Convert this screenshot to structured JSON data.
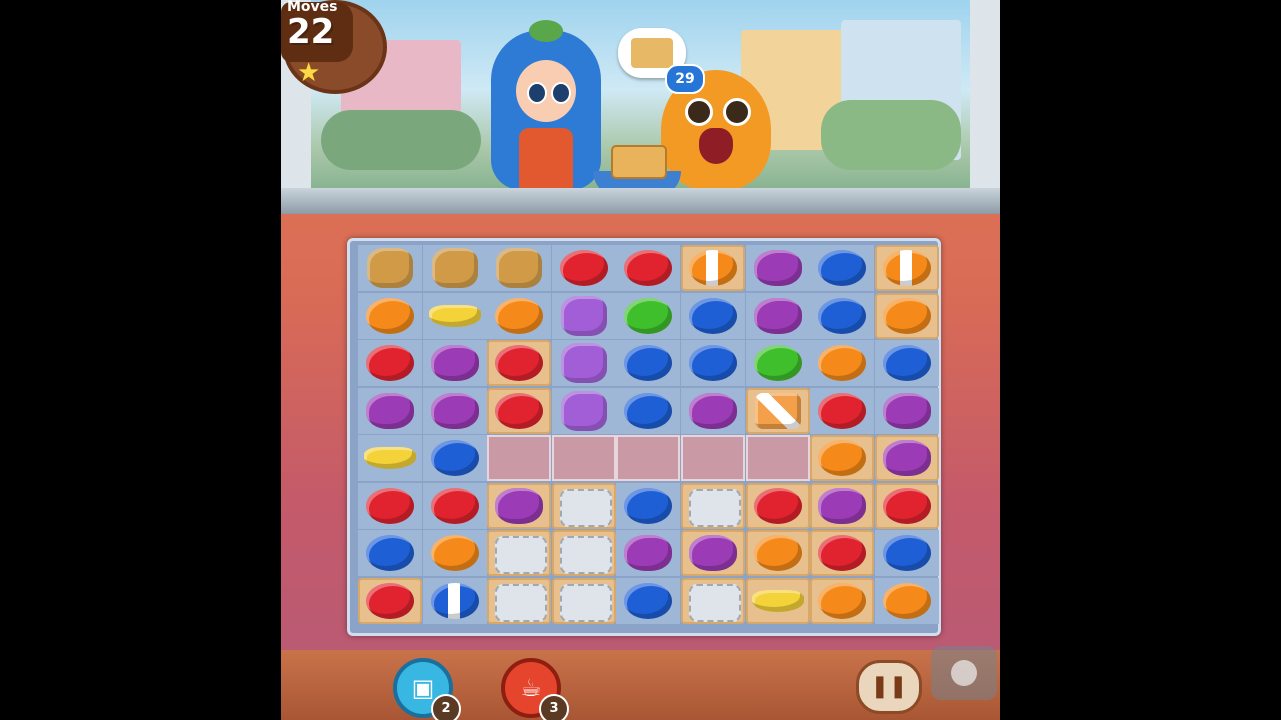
{
  "hud": {
    "moves_label": "Moves",
    "moves_value": "22",
    "goal_count": "29",
    "goal_item": "cracker-icon"
  },
  "boosters": [
    {
      "name": "apple-booster",
      "count": "2",
      "color": "#39b7e3"
    },
    {
      "name": "teapot-booster",
      "count": "3",
      "color": "#e4452c"
    }
  ],
  "board": {
    "rows": 8,
    "cols": 9,
    "grid": [
      [
        "cookie-burst",
        "cookie-burst",
        "cookie-burst",
        "strawberry",
        "strawberry",
        "orange-striped",
        "grape",
        "blueberry",
        "orange-striped"
      ],
      [
        "orange",
        "banana",
        "orange",
        "purple-burst",
        "apple",
        "blueberry",
        "grape",
        "blueberry",
        "orange"
      ],
      [
        "strawberry",
        "grape",
        "strawberry",
        "purple-burst",
        "blueberry",
        "blueberry",
        "apple",
        "orange",
        "blueberry"
      ],
      [
        "grape",
        "grape",
        "strawberry",
        "purple-burst",
        "blueberry",
        "grape",
        "orange-bomb",
        "strawberry",
        "grape"
      ],
      [
        "banana",
        "blueberry",
        "empty",
        "empty",
        "empty",
        "empty",
        "empty",
        "orange",
        "grape"
      ],
      [
        "strawberry",
        "strawberry",
        "grape",
        "basket",
        "blueberry",
        "basket",
        "strawberry",
        "grape",
        "strawberry"
      ],
      [
        "blueberry",
        "orange",
        "basket",
        "basket",
        "grape",
        "grape",
        "orange",
        "strawberry",
        "blueberry"
      ],
      [
        "strawberry",
        "blueberry-striped",
        "basket",
        "basket",
        "blueberry",
        "basket",
        "banana",
        "orange",
        "orange"
      ]
    ],
    "tiles": [
      [
        0,
        0,
        0,
        0,
        0,
        1,
        0,
        0,
        1
      ],
      [
        0,
        0,
        0,
        0,
        0,
        0,
        0,
        0,
        1
      ],
      [
        0,
        0,
        1,
        0,
        0,
        0,
        0,
        0,
        0
      ],
      [
        0,
        0,
        1,
        0,
        0,
        0,
        1,
        0,
        0
      ],
      [
        0,
        0,
        2,
        2,
        2,
        2,
        2,
        1,
        1
      ],
      [
        0,
        0,
        1,
        1,
        0,
        1,
        1,
        1,
        1
      ],
      [
        0,
        0,
        1,
        1,
        0,
        1,
        1,
        1,
        0
      ],
      [
        1,
        0,
        1,
        1,
        0,
        1,
        1,
        1,
        0
      ]
    ]
  },
  "piece_colors": {
    "strawberry": "#e0232e",
    "orange": "#f58a1a",
    "orange-striped": "#f58a1a",
    "orange-bomb": "#f4a04a",
    "grape": "#9b3bb5",
    "blueberry": "#1f5fd6",
    "blueberry-striped": "#1f5fd6",
    "apple": "#3fbf2c",
    "banana": "#f4d23a",
    "cookie-burst": "#d9962f",
    "purple-burst": "#a24fd6"
  },
  "controls": {
    "pause_icon": "pause-icon",
    "assist_icon": "assistive-touch-icon"
  }
}
